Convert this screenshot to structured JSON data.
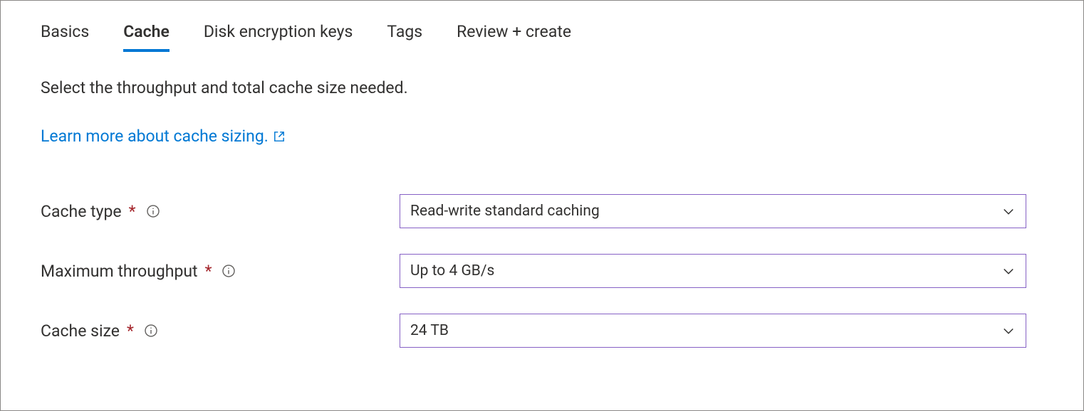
{
  "tabs": {
    "basics": "Basics",
    "cache": "Cache",
    "disk_encryption": "Disk encryption keys",
    "tags": "Tags",
    "review_create": "Review + create"
  },
  "description": "Select the throughput and total cache size needed.",
  "learn_more": "Learn more about cache sizing.",
  "form": {
    "cache_type": {
      "label": "Cache type",
      "value": "Read-write standard caching"
    },
    "max_throughput": {
      "label": "Maximum throughput",
      "value": "Up to 4 GB/s"
    },
    "cache_size": {
      "label": "Cache size",
      "value": "24 TB"
    }
  }
}
